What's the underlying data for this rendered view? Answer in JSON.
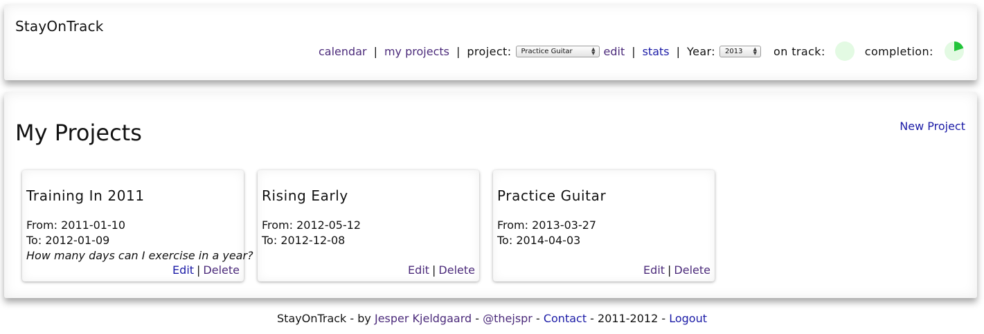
{
  "header": {
    "app_title": "StayOnTrack",
    "nav": {
      "calendar": "calendar",
      "my_projects": "my projects",
      "project_label": "project:",
      "project_selected": "Practice Guitar",
      "edit": "edit",
      "stats": "stats",
      "year_label": "Year:",
      "year_selected": "2013",
      "on_track_label": "on track:",
      "completion_label": "completion:",
      "separator": "|"
    },
    "indicators": {
      "on_track_fraction": 0,
      "completion_fraction": 0.2,
      "pie_fill_color": "#22c43a",
      "pie_background_color": "#e3fae3"
    }
  },
  "main": {
    "page_title": "My Projects",
    "new_project": "New Project",
    "projects": [
      {
        "title": "Training In 2011",
        "from": "From: 2011-01-10",
        "to": "To: 2012-01-09",
        "description": "How many days can I exercise in a year?",
        "edit": "Edit",
        "delete": "Delete"
      },
      {
        "title": "Rising Early",
        "from": "From: 2012-05-12",
        "to": "To: 2012-12-08",
        "description": "",
        "edit": "Edit",
        "delete": "Delete"
      },
      {
        "title": "Practice Guitar",
        "from": "From: 2013-03-27",
        "to": "To: 2014-04-03",
        "description": "",
        "edit": "Edit",
        "delete": "Delete"
      }
    ]
  },
  "footer": {
    "app_name": "StayOnTrack",
    "by_text": " - by ",
    "author": "Jesper Kjeldgaard",
    "dash": " - ",
    "twitter": "@thejspr",
    "contact": "Contact",
    "years": " - 2011-2012 - ",
    "logout": "Logout"
  },
  "colors": {
    "link_visited": "#4b2a7a",
    "link_blue": "#1a1aa6"
  }
}
